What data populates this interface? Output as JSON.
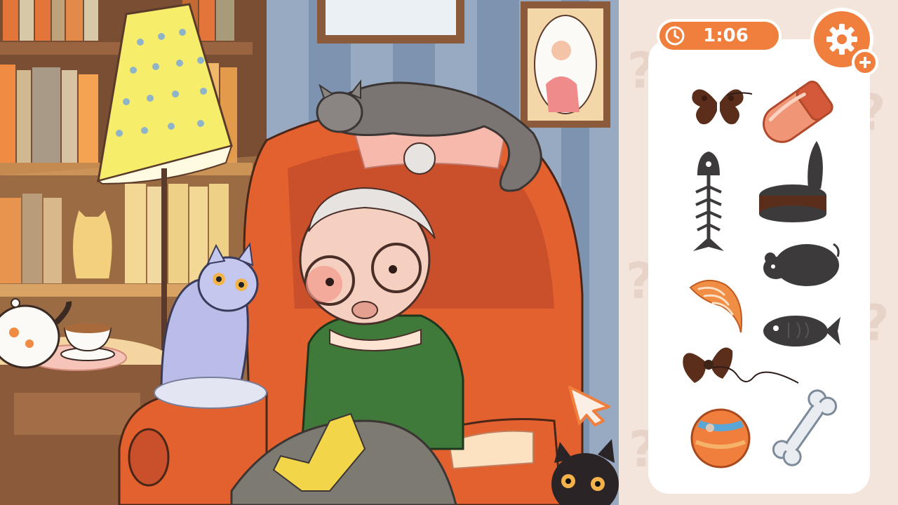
{
  "hud": {
    "timer_text": "1:06",
    "timer_icon": "clock-icon",
    "settings_icon": "gear-icon",
    "add_icon": "plus-icon"
  },
  "colors": {
    "accent": "#f07e3c",
    "panel": "#ffffff",
    "panel_bg": "#f3e4dc",
    "silhouette": "#3d3a3c",
    "wallpaper": "#8ea2ba"
  },
  "items_to_find": [
    {
      "name": "butterfly",
      "found": false
    },
    {
      "name": "sausage",
      "found": true
    },
    {
      "name": "fish-bone",
      "found": false
    },
    {
      "name": "open-tin-can",
      "found": false
    },
    {
      "name": "fish-fillet",
      "found": true
    },
    {
      "name": "mouse",
      "found": false
    },
    {
      "name": "bow-on-string",
      "found": false
    },
    {
      "name": "toy-fish",
      "found": false
    },
    {
      "name": "ball",
      "found": true
    },
    {
      "name": "bone",
      "found": true
    }
  ],
  "scene": {
    "description_icons": [
      "grandma",
      "armchair",
      "grey-cat",
      "lilac-cat",
      "black-cat",
      "lamp",
      "bookshelf",
      "teapot",
      "teacup",
      "picture-frame",
      "portrait-frame"
    ]
  }
}
